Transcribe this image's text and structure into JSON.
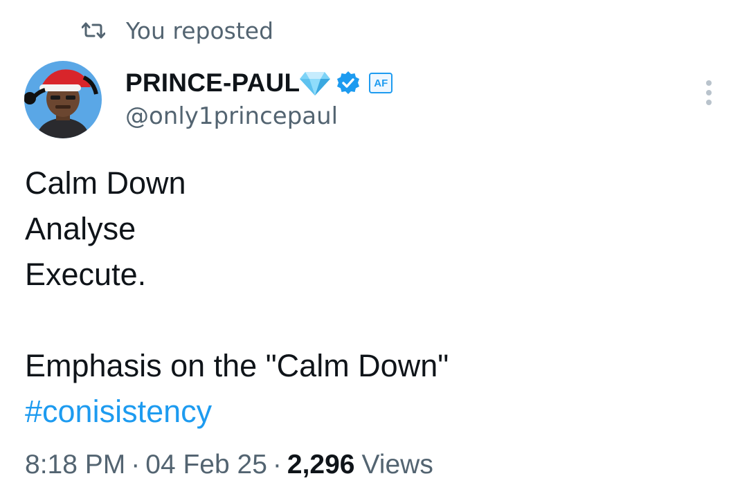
{
  "repost": {
    "icon": "repost-icon",
    "label": "You reposted"
  },
  "author": {
    "display_name": "PRINCE-PAUL",
    "handle": "@only1princepaul",
    "name_emoji_icon": "diamond-icon",
    "verified_icon": "verified-badge-icon",
    "affiliate_badge": "AF",
    "avatar_icon": "avatar-santa-hat"
  },
  "more_icon": "more-vertical-icon",
  "tweet": {
    "lines": [
      "Calm Down",
      "Analyse",
      "Execute.",
      "",
      "Emphasis on the \"Calm Down\""
    ],
    "hashtag": "#conisistency"
  },
  "meta": {
    "time": "8:18 PM",
    "separator": "·",
    "date": "04 Feb 25",
    "views_count": "2,296",
    "views_label": "Views"
  },
  "colors": {
    "text": "#0f1419",
    "secondary": "#536471",
    "accent": "#1d9bf0"
  }
}
